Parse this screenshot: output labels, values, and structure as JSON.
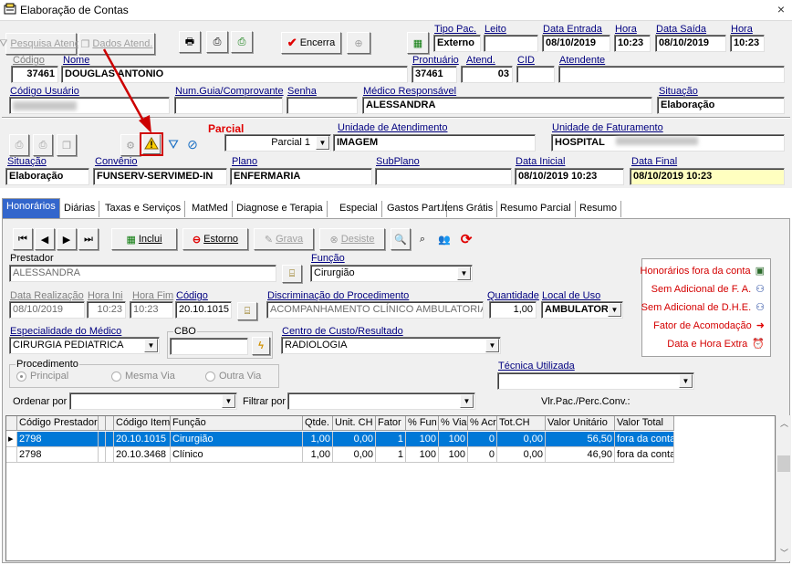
{
  "window": {
    "title": "Elaboração de Contas",
    "close": "×"
  },
  "toolbar": {
    "pesquisa_atend": "Pesquisa Atend.",
    "dados_atend": "Dados Atend.",
    "encerra": "Encerra"
  },
  "header": {
    "tipo_pac_label": "Tipo Pac.",
    "tipo_pac": "Externo",
    "leito_label": "Leito",
    "leito": "",
    "data_entrada_label": "Data Entrada",
    "data_entrada": "08/10/2019",
    "hora_entrada_label": "Hora",
    "hora_entrada": "10:23",
    "data_saida_label": "Data Saída",
    "data_saida": "08/10/2019",
    "hora_saida_label": "Hora",
    "hora_saida": "10:23",
    "codigo_label": "Código",
    "codigo": "37461",
    "nome_label": "Nome",
    "nome": "DOUGLAS ANTONIO",
    "prontuario_label": "Prontuário",
    "prontuario": "37461",
    "atend_label": "Atend.",
    "atend": "03",
    "cid_label": "CID",
    "cid": "",
    "atendente_label": "Atendente",
    "atendente": "",
    "codigo_usuario_label": "Código Usuário",
    "num_guia_label": "Num.Guia/Comprovante",
    "num_guia": "",
    "senha_label": "Senha",
    "senha": "",
    "medico_label": "Médico Responsável",
    "medico": "ALESSANDRA",
    "situacao_label": "Situação",
    "situacao": "Elaboração"
  },
  "partial": {
    "parcial_label": "Parcial",
    "parcial_value": "Parcial 1",
    "unidade_atend_label": "Unidade de Atendimento",
    "unidade_atend": "IMAGEM",
    "unidade_fat_label": "Unidade de Faturamento",
    "unidade_fat": "HOSPITAL",
    "situacao_label": "Situação",
    "situacao": "Elaboração",
    "convenio_label": "Convênio",
    "convenio": "FUNSERV-SERVIMED-IN",
    "plano_label": "Plano",
    "plano": "ENFERMARIA",
    "subplano_label": "SubPlano",
    "subplano": "",
    "data_inicial_label": "Data Inicial",
    "data_inicial": "08/10/2019 10:23",
    "data_final_label": "Data Final",
    "data_final": "08/10/2019 10:23"
  },
  "tabs": [
    "Honorários",
    "Diárias",
    "Taxas e Serviços",
    "MatMed",
    "Diagnose e Terapia",
    "Especial",
    "Gastos Part.",
    "Itens Grátis",
    "Resumo Parcial",
    "Resumo"
  ],
  "actions": {
    "inclui": "Inclui",
    "estorno": "Estorno",
    "grava": "Grava",
    "desiste": "Desiste"
  },
  "form": {
    "prestador_label": "Prestador",
    "prestador": "ALESSANDRA",
    "funcao_label": "Função",
    "funcao": "Cirurgião",
    "data_realizacao_label": "Data Realização",
    "data_realizacao": "08/10/2019",
    "hora_ini_label": "Hora Ini",
    "hora_ini": "10:23",
    "hora_fim_label": "Hora Fim",
    "hora_fim": "10:23",
    "codigo_label": "Código",
    "codigo": "20.10.1015",
    "discriminacao_label": "Discriminação do Procedimento",
    "discriminacao": "ACOMPANHAMENTO CLÍNICO AMBULATORIAL",
    "quantidade_label": "Quantidade",
    "quantidade": "1,00",
    "local_uso_label": "Local de Uso",
    "local_uso": "AMBULATORI",
    "especialidade_label": "Especialidade do Médico",
    "especialidade": "CIRURGIA PEDIATRICA",
    "cbo_label": "CBO",
    "cbo": "",
    "centro_custo_label": "Centro de Custo/Resultado",
    "centro_custo": "RADIOLOGIA",
    "procedimento_label": "Procedimento",
    "principal": "Principal",
    "mesma_via": "Mesma Via",
    "outra_via": "Outra Via",
    "tecnica_label": "Técnica Utilizada",
    "tecnica": "",
    "ordenar_label": "Ordenar por",
    "ordenar": "",
    "filtrar_label": "Filtrar por",
    "filtrar": "",
    "vlr_pac_label": "Vlr.Pac./Perc.Conv.:"
  },
  "legend": {
    "honorarios_fora": "Honorários fora da conta",
    "sem_fa": "Sem Adicional de F. A.",
    "sem_dhe": "Sem Adicional de D.H.E.",
    "fator_acomodacao": "Fator de Acomodação",
    "data_hora_extra": "Data e Hora Extra"
  },
  "grid": {
    "headers": [
      "Código Prestador",
      "",
      "",
      "Código Item",
      "Função",
      "Qtde.",
      "Unit. CH",
      "Fator",
      "% Fun",
      "% Via",
      "% Acr",
      "Tot.CH",
      "Valor Unitário",
      "Valor Total"
    ],
    "rows": [
      [
        "2798",
        "",
        "",
        "20.10.1015",
        "Cirurgião",
        "1,00",
        "0,00",
        "1",
        "100",
        "100",
        "0",
        "0,00",
        "56,50",
        "fora da conta"
      ],
      [
        "2798",
        "",
        "",
        "20.10.3468",
        "Clínico",
        "1,00",
        "0,00",
        "1",
        "100",
        "100",
        "0",
        "0,00",
        "46,90",
        "fora da conta"
      ]
    ]
  },
  "colors": {
    "tab_active": "#3366cc",
    "selection": "#0078d7",
    "legend_text": "#d40000",
    "annotation": "#cc0000"
  }
}
